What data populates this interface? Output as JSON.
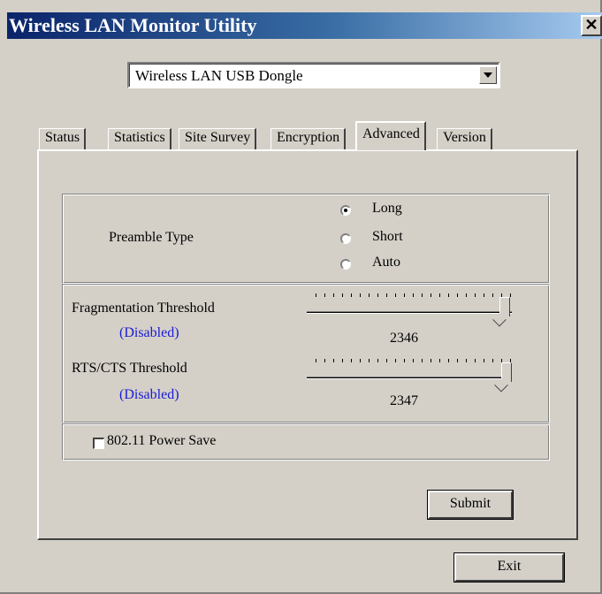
{
  "window": {
    "title": "Wireless LAN Monitor Utility",
    "close_glyph": "✕"
  },
  "device_select": {
    "selected": "Wireless LAN USB Dongle"
  },
  "tabs": [
    {
      "label": "Status"
    },
    {
      "label": "Statistics"
    },
    {
      "label": "Site Survey"
    },
    {
      "label": "Encryption"
    },
    {
      "label": "Advanced",
      "active": true
    },
    {
      "label": "Version"
    }
  ],
  "advanced": {
    "preamble": {
      "label": "Preamble Type",
      "options": [
        "Long",
        "Short",
        "Auto"
      ],
      "selected": "Long"
    },
    "fragmentation": {
      "label": "Fragmentation Threshold",
      "status": "(Disabled)",
      "value": "2346"
    },
    "rts_cts": {
      "label": "RTS/CTS Threshold",
      "status": "(Disabled)",
      "value": "2347"
    },
    "power_save": {
      "label": "802.11 Power Save",
      "checked": false
    },
    "submit_label": "Submit"
  },
  "exit_label": "Exit",
  "colors": {
    "disabled_text": "#1a1ad6",
    "title_bar": "#0a246a"
  }
}
